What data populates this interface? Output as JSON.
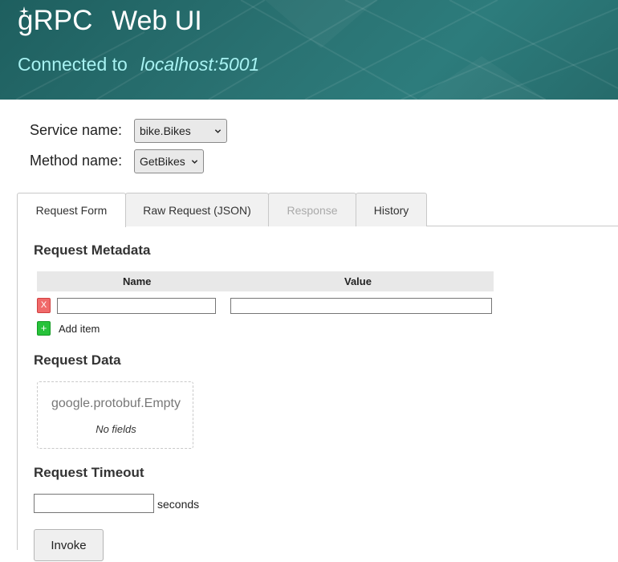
{
  "header": {
    "logo_text": "gRPC",
    "app_title": "Web UI",
    "connected_label": "Connected to",
    "host": "localhost:5001"
  },
  "selectors": {
    "service_label": "Service name:",
    "service_value": "bike.Bikes",
    "method_label": "Method name:",
    "method_value": "GetBikes"
  },
  "tabs": [
    {
      "label": "Request Form",
      "state": "active"
    },
    {
      "label": "Raw Request (JSON)",
      "state": "normal"
    },
    {
      "label": "Response",
      "state": "disabled"
    },
    {
      "label": "History",
      "state": "normal"
    }
  ],
  "metadata": {
    "title": "Request Metadata",
    "col_name": "Name",
    "col_value": "Value",
    "remove_glyph": "X",
    "add_glyph": "+",
    "add_label": "Add item",
    "rows": [
      {
        "name": "",
        "value": ""
      }
    ]
  },
  "request_data": {
    "title": "Request Data",
    "message_type": "google.protobuf.Empty",
    "no_fields": "No fields"
  },
  "timeout": {
    "title": "Request Timeout",
    "value": "",
    "unit": "seconds"
  },
  "invoke_label": "Invoke",
  "colors": {
    "header_bg": "#2a7272",
    "header_text": "#ffffff",
    "connected_text": "#a7f2f2",
    "remove_button": "#f06a6a",
    "add_button": "#27c23a"
  },
  "icons": {
    "logo_spark": "sparkle-icon",
    "select_chevron": "chevron-down-icon",
    "remove": "close-icon",
    "add": "plus-icon"
  }
}
